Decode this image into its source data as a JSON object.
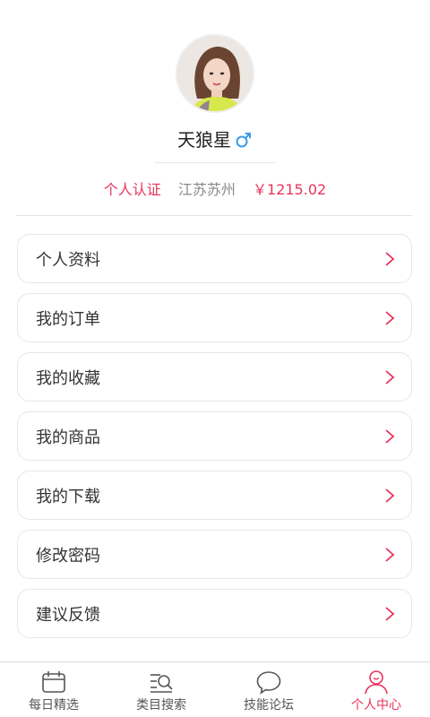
{
  "profile": {
    "name": "天狼星",
    "gender_icon": "male-symbol-icon",
    "certification": "个人认证",
    "location": "江苏苏州",
    "balance": "￥1215.02"
  },
  "colors": {
    "accent": "#e8345a",
    "gender": "#3b9be8"
  },
  "menu": {
    "items": [
      {
        "label": "个人资料"
      },
      {
        "label": "我的订单"
      },
      {
        "label": "我的收藏"
      },
      {
        "label": "我的商品"
      },
      {
        "label": "我的下载"
      },
      {
        "label": "修改密码"
      },
      {
        "label": "建议反馈"
      }
    ]
  },
  "tabbar": {
    "tabs": [
      {
        "label": "每日精选",
        "icon": "calendar-icon"
      },
      {
        "label": "类目搜索",
        "icon": "list-search-icon"
      },
      {
        "label": "技能论坛",
        "icon": "chat-bubble-icon"
      },
      {
        "label": "个人中心",
        "icon": "person-icon",
        "active": true
      }
    ]
  }
}
